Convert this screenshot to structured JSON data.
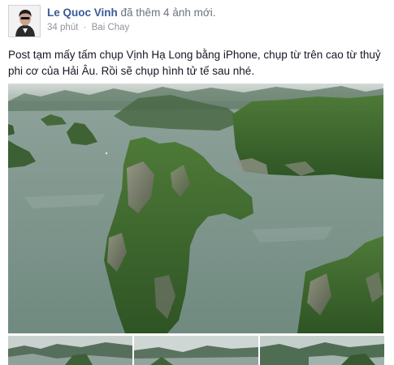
{
  "post": {
    "author_name": "Le Quoc Vinh",
    "action_text": "đã thêm 4 ảnh mới.",
    "time": "34 phút",
    "separator": "·",
    "location": "Bai Chay",
    "caption": "Post tạm mấy tấm chụp Vịnh Hạ Long bằng iPhone, chụp từ trên cao từ thuỷ phi cơ của Hải Âu. Rồi sẽ chụp hình tử tế sau nhé.",
    "photo_count": 4,
    "thumbnail_count": 3,
    "colors": {
      "author_link": "#3b5998",
      "meta_text": "#90949c",
      "sea": "#7c9289",
      "island": "#3f6b2e"
    }
  }
}
